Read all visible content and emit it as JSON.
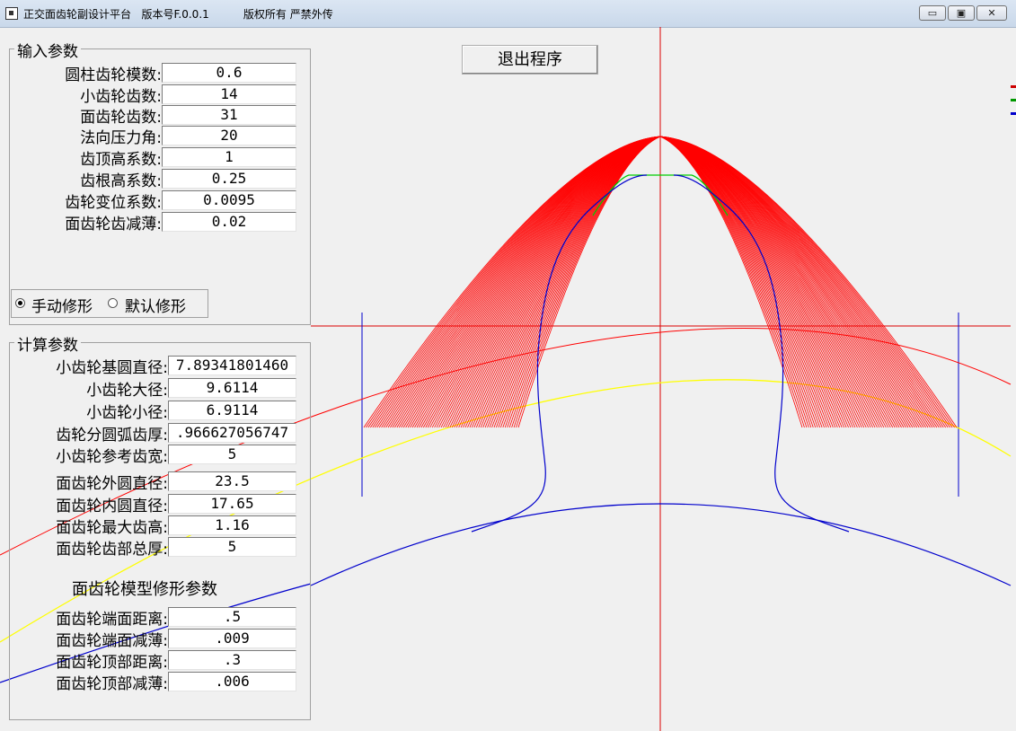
{
  "window": {
    "title": "正交面齿轮副设计平台   版本号F.0.0.1          版权所有 严禁外传",
    "min_glyph": "▭",
    "max_glyph": "▣",
    "close_glyph": "✕"
  },
  "exit_button": "退出程序",
  "input_group": {
    "title": "输入参数",
    "fields": [
      {
        "label": "圆柱齿轮模数:",
        "value": "0.6"
      },
      {
        "label": "小齿轮齿数:",
        "value": "14"
      },
      {
        "label": "面齿轮齿数:",
        "value": "31"
      },
      {
        "label": "法向压力角:",
        "value": "20"
      },
      {
        "label": "齿顶高系数:",
        "value": "1"
      },
      {
        "label": "齿根高系数:",
        "value": "0.25"
      },
      {
        "label": "齿轮变位系数:",
        "value": "0.0095"
      },
      {
        "label": "面齿轮齿减薄:",
        "value": "0.02"
      }
    ]
  },
  "mode": {
    "manual": "手动修形",
    "default": "默认修形",
    "selected": "manual"
  },
  "calc_group": {
    "title": "计算参数",
    "fields": [
      {
        "label": "小齿轮基圆直径:",
        "value": "7.89341801460"
      },
      {
        "label": "小齿轮大径:",
        "value": "9.6114"
      },
      {
        "label": "小齿轮小径:",
        "value": "6.9114"
      },
      {
        "label": "齿轮分圆弧齿厚:",
        "value": ".966627056747"
      },
      {
        "label": "小齿轮参考齿宽:",
        "value": "5"
      },
      {
        "label": "面齿轮外圆直径:",
        "value": "23.5"
      },
      {
        "label": "面齿轮内圆直径:",
        "value": "17.65"
      },
      {
        "label": "面齿轮最大齿高:",
        "value": "1.16"
      },
      {
        "label": "面齿轮齿部总厚:",
        "value": "5"
      }
    ],
    "mod_heading": "面齿轮模型修形参数",
    "mod_fields": [
      {
        "label": "面齿轮端面距离:",
        "value": ".5"
      },
      {
        "label": "面齿轮端面减薄:",
        "value": ".009"
      },
      {
        "label": "面齿轮顶部距离:",
        "value": ".3"
      },
      {
        "label": "面齿轮顶部减薄:",
        "value": ".006"
      }
    ]
  },
  "colors": {
    "tooth": "#ff0000",
    "axis": "#dd0000",
    "pinion": "#0000cc",
    "tip": "#00cc00",
    "pitch": "#ffff00"
  }
}
